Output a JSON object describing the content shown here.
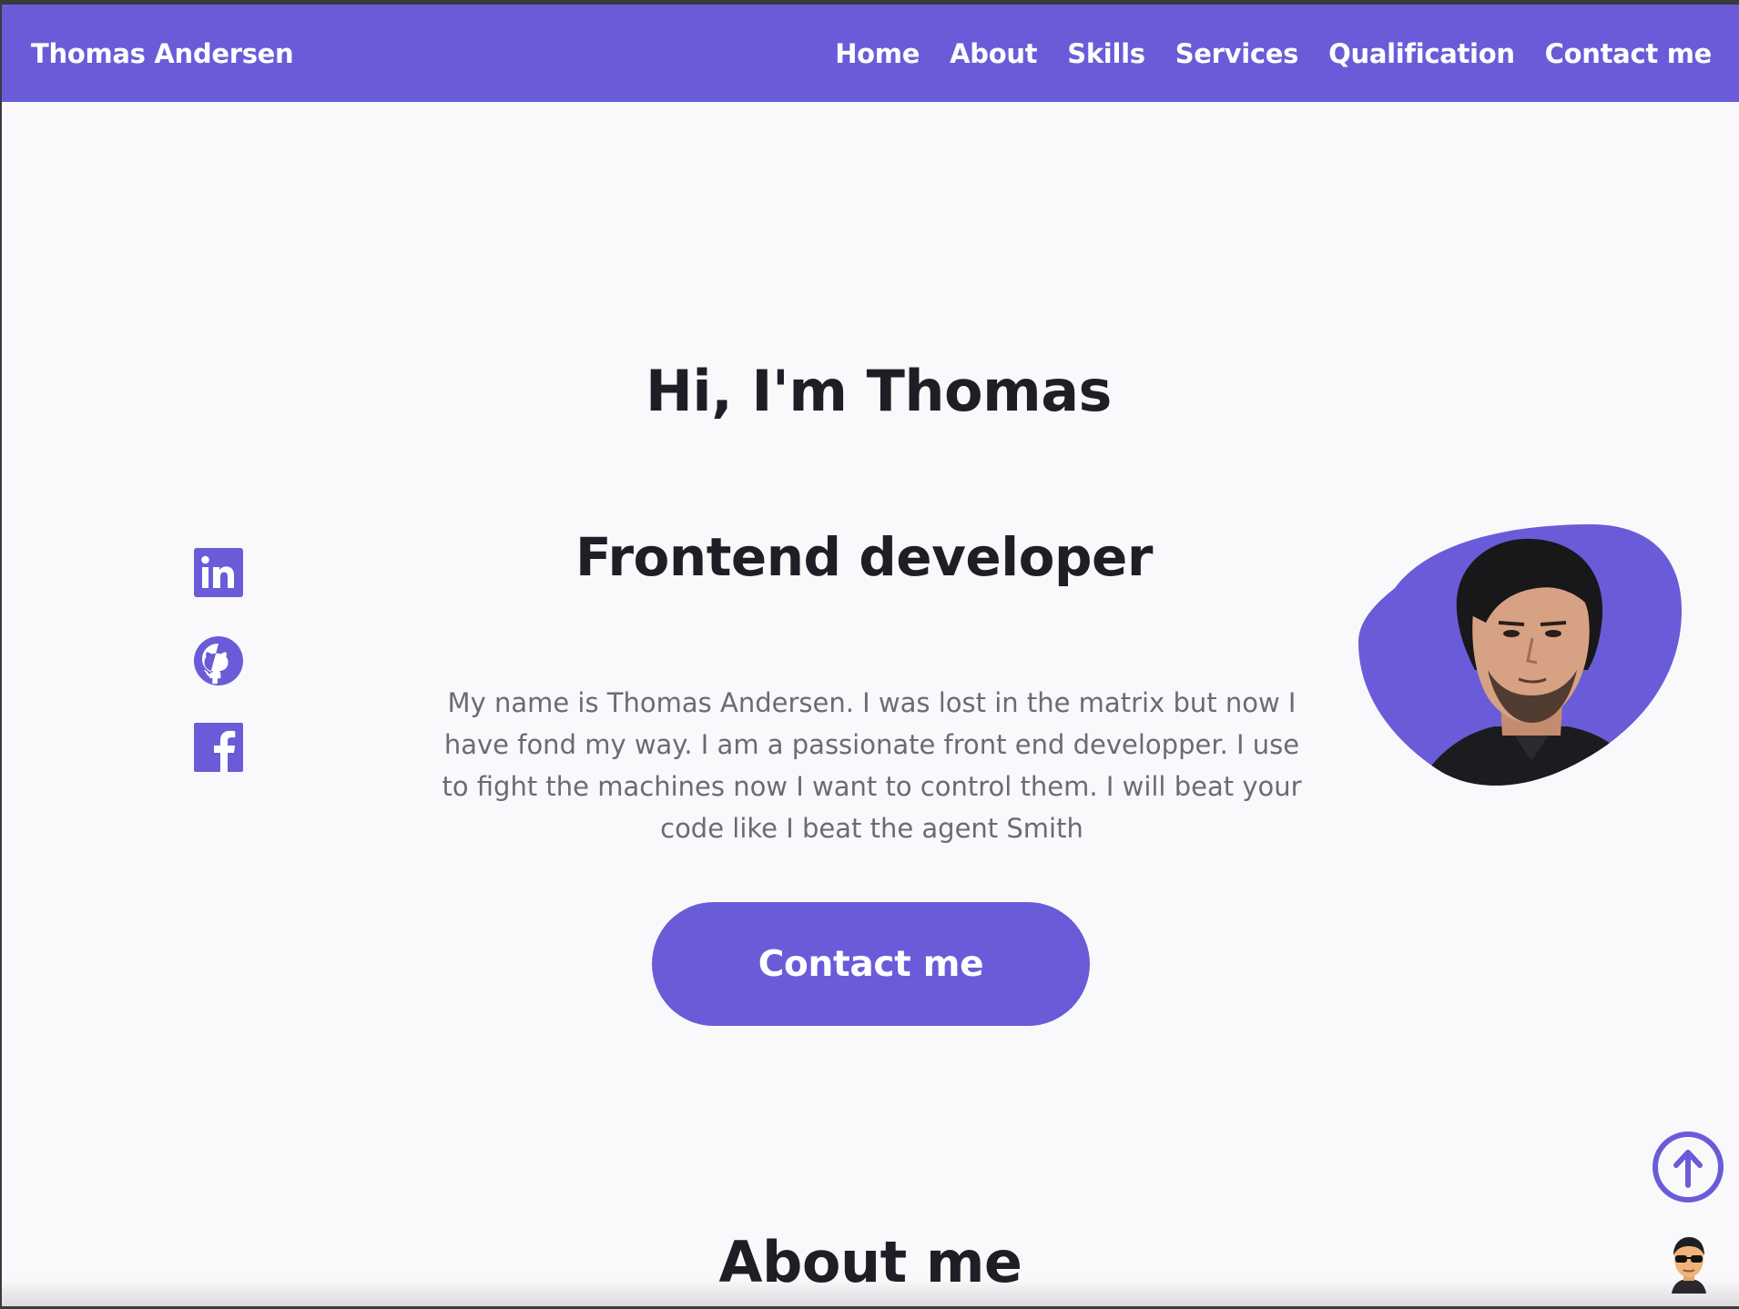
{
  "header": {
    "brand": "Thomas Andersen",
    "nav": [
      {
        "label": "Home"
      },
      {
        "label": "About"
      },
      {
        "label": "Skills"
      },
      {
        "label": "Services"
      },
      {
        "label": "Qualification"
      },
      {
        "label": "Contact me"
      }
    ]
  },
  "hero": {
    "greeting": "Hi, I'm Thomas",
    "role": "Frontend developer",
    "description": "My name is Thomas Andersen. I was lost in the matrix but now I have fond my way. I am a passionate front end developper. I use to fight the machines now I want to control them. I will beat your code like I beat the agent Smith",
    "contact_button": "Contact me",
    "social": [
      {
        "icon": "linkedin-icon"
      },
      {
        "icon": "github-icon"
      },
      {
        "icon": "facebook-icon"
      }
    ]
  },
  "about": {
    "title": "About me"
  },
  "colors": {
    "accent": "#6a5cd8",
    "text_dark": "#1f1e26",
    "text_muted": "#6b6a76",
    "background": "#f9f9fb"
  }
}
